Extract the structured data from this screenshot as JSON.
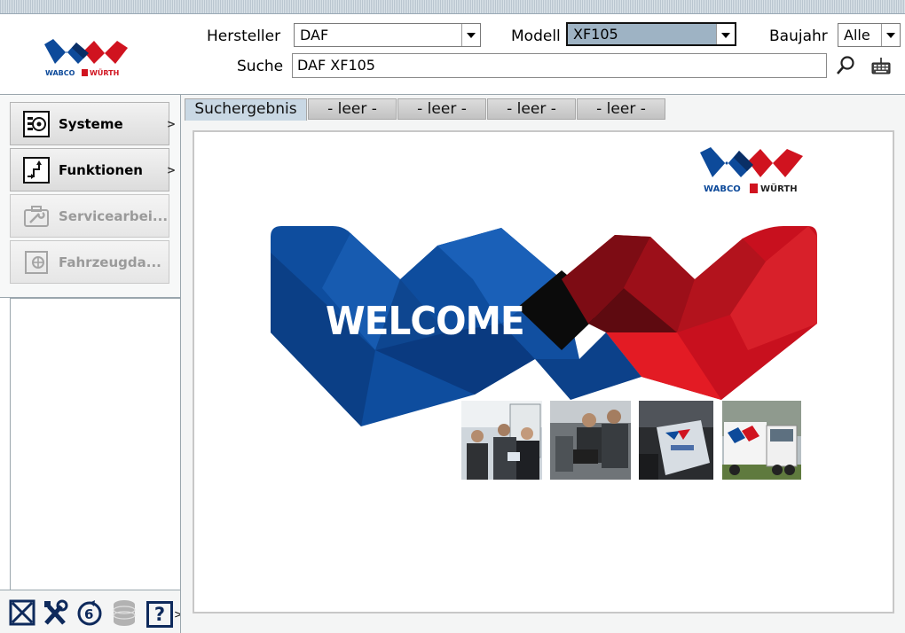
{
  "header": {
    "brand_left": "WABCO",
    "brand_right": "WÜRTH",
    "manufacturer_label": "Hersteller",
    "manufacturer_value": "DAF",
    "model_label": "Modell",
    "model_value": "XF105",
    "year_label": "Baujahr",
    "year_value": "Alle",
    "search_label": "Suche",
    "search_value": "DAF XF105"
  },
  "nav": {
    "items": [
      {
        "label": "Systeme",
        "icon": "systems-icon",
        "enabled": true
      },
      {
        "label": "Funktionen",
        "icon": "functions-icon",
        "enabled": true
      },
      {
        "label": "Servicearbei...",
        "icon": "toolbox-icon",
        "enabled": false
      },
      {
        "label": "Fahrzeugda...",
        "icon": "vehicle-data-icon",
        "enabled": false
      }
    ],
    "chevron": ">"
  },
  "bottom_toolbar": {
    "icons": [
      "close-box-icon",
      "tools-icon",
      "update-icon",
      "database-icon",
      "help-icon"
    ],
    "help_glyph": "?",
    "more_glyph": ">"
  },
  "tabs": [
    {
      "label": "Suchergebnis",
      "active": true
    },
    {
      "label": "- leer -",
      "active": false
    },
    {
      "label": "- leer -",
      "active": false
    },
    {
      "label": "- leer -",
      "active": false
    },
    {
      "label": "- leer -",
      "active": false
    }
  ],
  "welcome": {
    "text": "WELCOME"
  },
  "colors": {
    "blue": "#0d4a9a",
    "red": "#d0131f",
    "tab_active": "#c9d8e4",
    "model_selected": "#9eb3c4"
  }
}
